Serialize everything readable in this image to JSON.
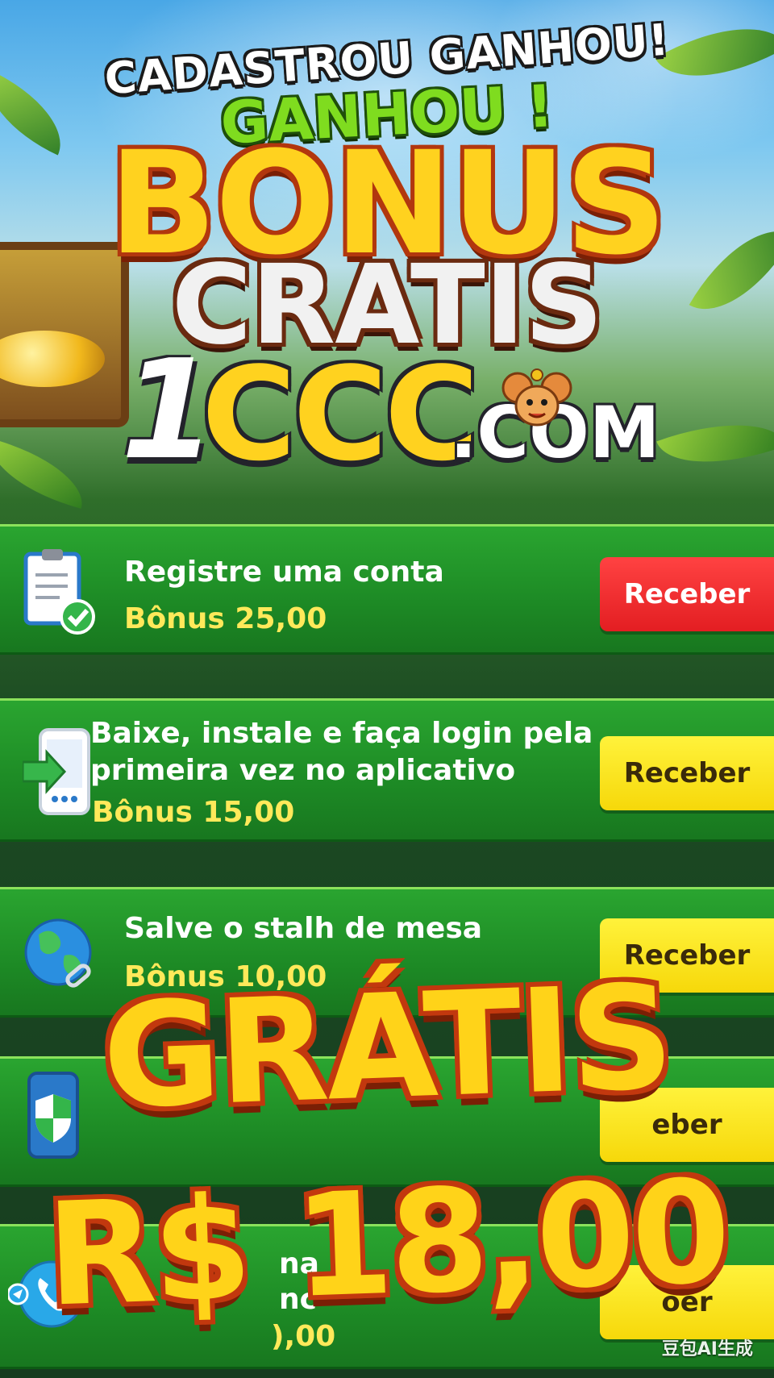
{
  "header": {
    "line1": "CADASTROU GANHOU!",
    "line2": "GANHOU !",
    "line3": "BONUS",
    "line4": "CRATIS",
    "domain_num": "1",
    "domain_ccc": "CCC",
    "domain_tld": ".COM"
  },
  "tasks": [
    {
      "title_1": "Registre uma conta",
      "title_2": "",
      "bonus": "Bônus 25,00",
      "button": "Receber",
      "button_color": "#e31e22",
      "icon": "clipboard-check-icon"
    },
    {
      "title_1": "Baixe, instale e faça login pela",
      "title_2": "primeira vez no aplicativo",
      "bonus": "Bônus  15,00",
      "button": "Receber",
      "button_color": "#f6d80a",
      "icon": "phone-download-icon"
    },
    {
      "title_1": "Salve o stalh de mesa",
      "title_2": "",
      "bonus": "Bônus 10,00",
      "button": "Receber",
      "button_color": "#f6d80a",
      "icon": "globe-link-icon"
    },
    {
      "title_1": "",
      "title_2": "",
      "bonus": "",
      "button": "eber",
      "button_color": "#f6d80a",
      "icon": "phone-shield-icon"
    },
    {
      "title_1": "na",
      "title_2": "nc",
      "bonus": "),00",
      "button": "oer",
      "button_color": "#f6d80a",
      "icon": "phone-call-icon"
    }
  ],
  "overlay": {
    "gratis": "GRÁTIS",
    "amount": "R$ 18,00"
  },
  "watermark": "豆包AI生成",
  "colors": {
    "green_row": "#1d8a25",
    "gold": "#ffd319",
    "red_button": "#e31e22",
    "yellow_button": "#f6d80a"
  }
}
